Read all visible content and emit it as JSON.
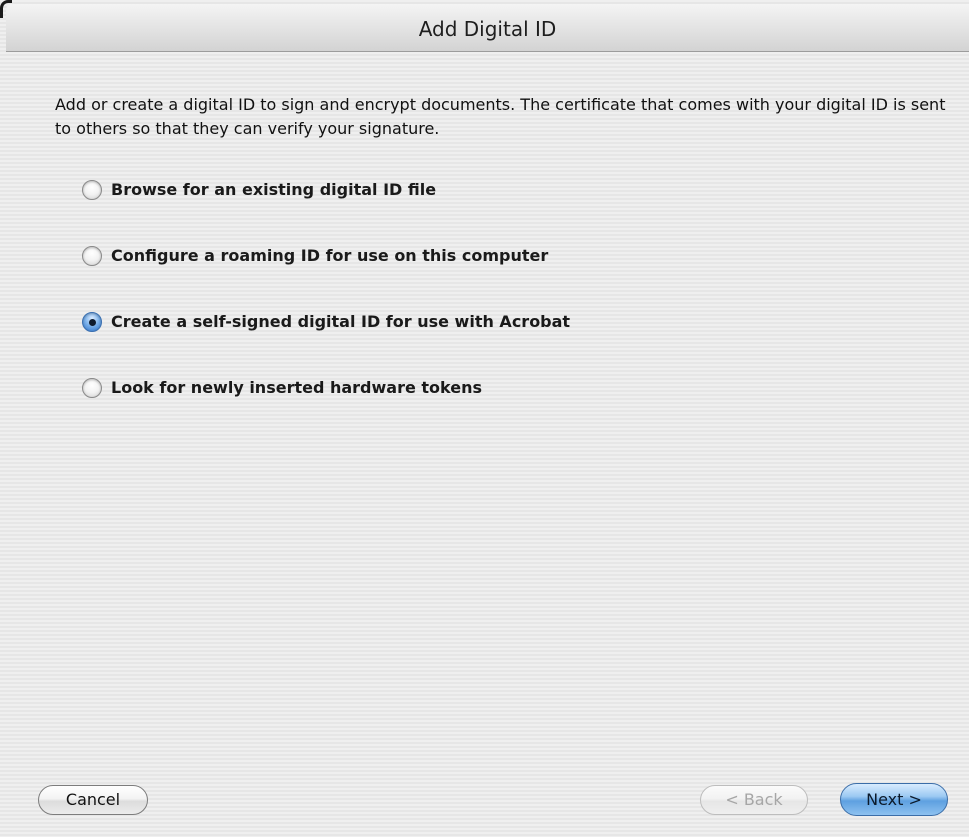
{
  "dialog": {
    "title": "Add Digital ID",
    "description": "Add or create a digital ID to sign and encrypt documents. The certificate that comes with your digital ID is sent to others so that they can verify your signature."
  },
  "options": [
    {
      "label": "Browse for an existing digital ID file",
      "selected": false
    },
    {
      "label": "Configure a roaming ID for use on this computer",
      "selected": false
    },
    {
      "label": "Create a self-signed digital ID for use with Acrobat",
      "selected": true
    },
    {
      "label": "Look for newly inserted hardware tokens",
      "selected": false
    }
  ],
  "buttons": {
    "cancel": "Cancel",
    "back": "< Back",
    "next": "Next >",
    "back_enabled": false
  },
  "colors": {
    "accent": "#5ea0e0",
    "selected_radio": "#2c72c9"
  }
}
